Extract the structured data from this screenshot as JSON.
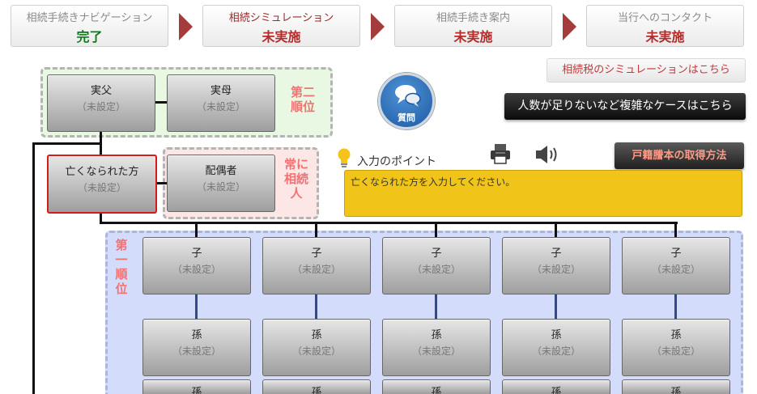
{
  "nav": [
    {
      "title": "相続手続きナビゲーション",
      "status": "完了",
      "status_color": "#0a7d1a"
    },
    {
      "title": "相続シミュレーション",
      "status": "未実施",
      "status_color": "#b52b2b"
    },
    {
      "title": "相続手続き案内",
      "status": "未実施",
      "status_color": "#b52b2b"
    },
    {
      "title": "当行へのコンタクト",
      "status": "未実施",
      "status_color": "#b52b2b"
    }
  ],
  "links": {
    "simulation": "相続税のシミュレーションはこちら",
    "complex_case": "人数が足りないなど複雑なケースはこちら",
    "koseki": "戸籍謄本の取得方法"
  },
  "question": {
    "label": "質問"
  },
  "input_point": {
    "label": "入力のポイント",
    "message": "亡くなられた方を入力してください。"
  },
  "zones": {
    "second": "第二順位",
    "always": "常に相続人",
    "first": "第一順位"
  },
  "unset": "（未設定）",
  "people": {
    "father": "実父",
    "mother": "実母",
    "deceased": "亡くなられた方",
    "spouse": "配偶者",
    "child": "子",
    "grandchild": "孫"
  },
  "colors": {
    "accent_red": "#a43c3c",
    "zone_label": "#f07373",
    "point_box": "#f0c419"
  }
}
